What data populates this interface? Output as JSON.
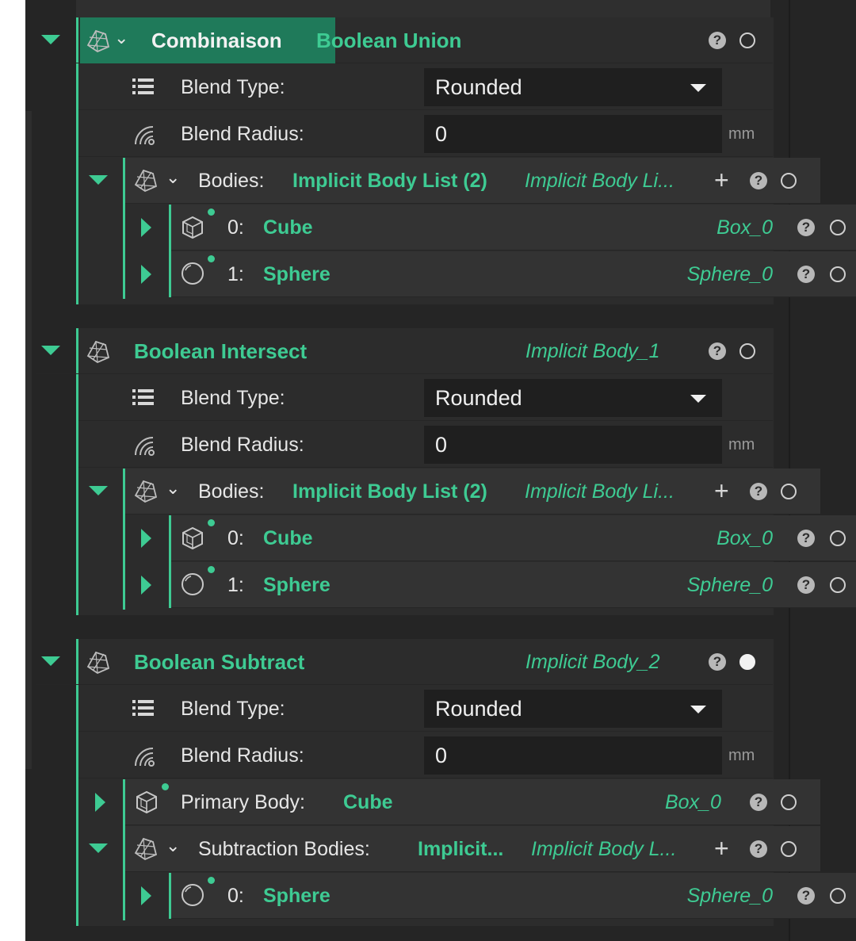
{
  "groups": [
    {
      "name": "Combinaison",
      "title": "Boolean Union",
      "blend_type_label": "Blend Type:",
      "blend_type_value": "Rounded",
      "blend_radius_label": "Blend Radius:",
      "blend_radius_value": "0",
      "unit": "mm",
      "bodies": {
        "label": "Bodies:",
        "value": "Implicit Body List (2)",
        "type": "Implicit Body Li...",
        "items": [
          {
            "index": "0:",
            "name": "Cube",
            "type": "Box_0"
          },
          {
            "index": "1:",
            "name": "Sphere",
            "type": "Sphere_0"
          }
        ]
      }
    },
    {
      "title": "Boolean Intersect",
      "type": "Implicit Body_1",
      "blend_type_label": "Blend Type:",
      "blend_type_value": "Rounded",
      "blend_radius_label": "Blend Radius:",
      "blend_radius_value": "0",
      "unit": "mm",
      "bodies": {
        "label": "Bodies:",
        "value": "Implicit Body List (2)",
        "type": "Implicit Body Li...",
        "items": [
          {
            "index": "0:",
            "name": "Cube",
            "type": "Box_0"
          },
          {
            "index": "1:",
            "name": "Sphere",
            "type": "Sphere_0"
          }
        ]
      }
    },
    {
      "title": "Boolean Subtract",
      "type": "Implicit Body_2",
      "blend_type_label": "Blend Type:",
      "blend_type_value": "Rounded",
      "blend_radius_label": "Blend Radius:",
      "blend_radius_value": "0",
      "unit": "mm",
      "primary": {
        "label": "Primary Body:",
        "name": "Cube",
        "type": "Box_0"
      },
      "subtraction": {
        "label": "Subtraction Bodies:",
        "value": "Implicit...",
        "type": "Implicit Body L...",
        "items": [
          {
            "index": "0:",
            "name": "Sphere",
            "type": "Sphere_0"
          }
        ]
      }
    }
  ],
  "colors": {
    "accent": "#3ecb93",
    "panel": "#2c2c2c",
    "background": "#252525"
  },
  "icons": [
    "implicit-body-icon",
    "list-icon",
    "radius-icon",
    "cube-icon",
    "sphere-icon",
    "help-icon",
    "ring-icon",
    "plus-icon",
    "chevron-down-icon"
  ]
}
